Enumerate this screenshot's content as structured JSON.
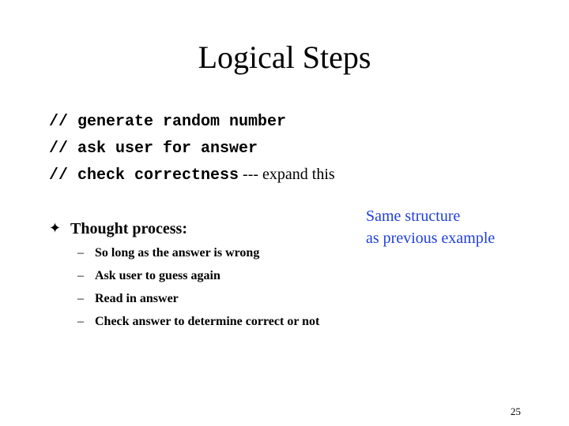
{
  "slide": {
    "title": "Logical Steps",
    "code_lines": [
      {
        "code": "// generate random number",
        "note": ""
      },
      {
        "code": "// ask user for answer",
        "note": ""
      },
      {
        "code": "// check correctness",
        "note": " --- expand this"
      }
    ],
    "callout": [
      "Same structure",
      "as previous example"
    ],
    "callout_color": "#1f3fdb",
    "bullet": {
      "glyph": "✦",
      "text": "Thought process:",
      "sub_items": [
        "So long as the answer is wrong",
        "Ask user to guess again",
        "Read in answer",
        "Check answer to determine correct or not"
      ],
      "dash": "–"
    },
    "page_number": "25"
  }
}
